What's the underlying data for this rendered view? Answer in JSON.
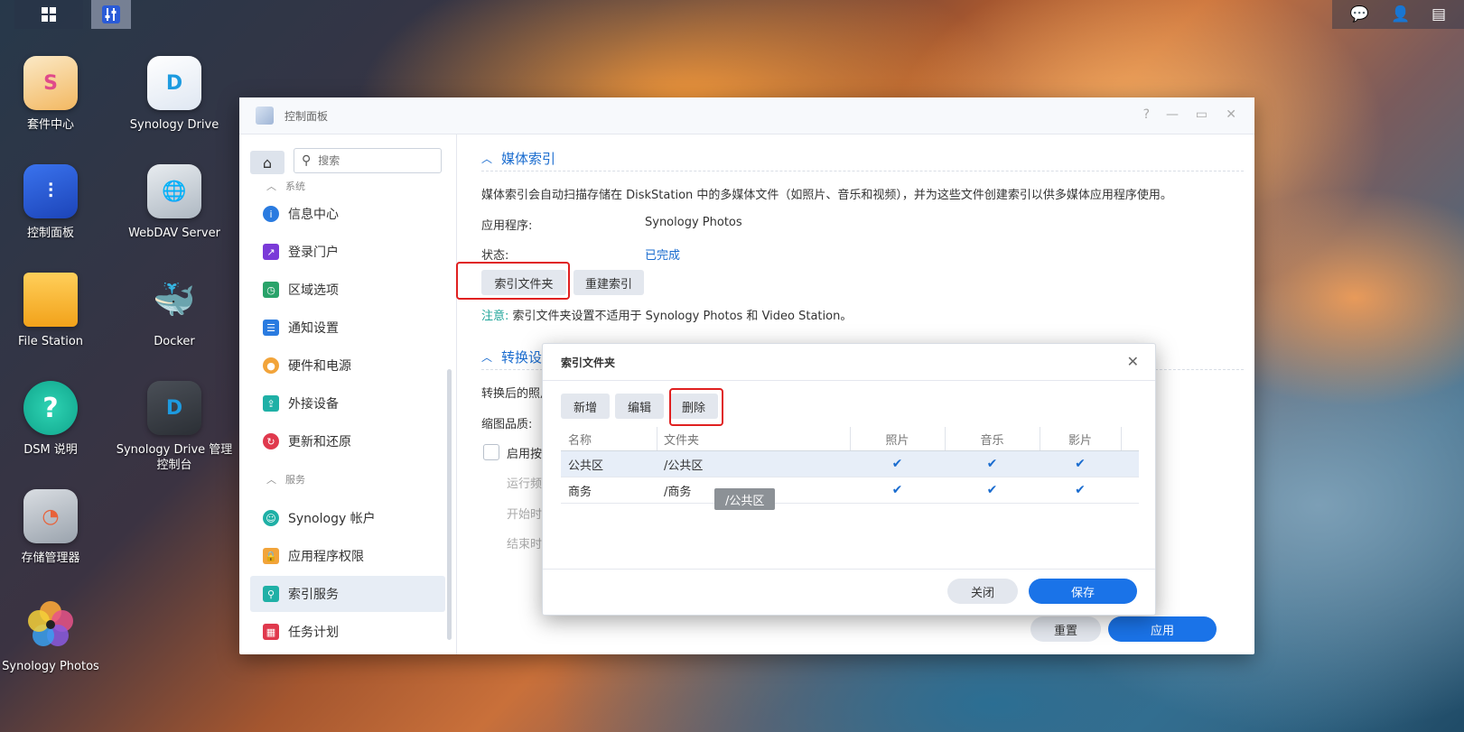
{
  "desktop": {
    "icons": [
      {
        "label": "套件中心"
      },
      {
        "label": "Synology Drive"
      },
      {
        "label": "控制面板"
      },
      {
        "label": "WebDAV Server"
      },
      {
        "label": "File Station"
      },
      {
        "label": "Docker"
      },
      {
        "label": "DSM 说明"
      },
      {
        "label": "Synology Drive 管理控制台"
      },
      {
        "label": "存储管理器"
      },
      {
        "label": "Synology Photos"
      }
    ]
  },
  "window": {
    "title": "控制面板",
    "controls": {
      "help": "?",
      "minimize": "—",
      "maximize": "▭",
      "close": "✕"
    }
  },
  "sidebar": {
    "search_placeholder": "搜索",
    "section_system": "系统",
    "section_services": "服务",
    "items": [
      {
        "label": "信息中心"
      },
      {
        "label": "登录门户"
      },
      {
        "label": "区域选项"
      },
      {
        "label": "通知设置"
      },
      {
        "label": "硬件和电源"
      },
      {
        "label": "外接设备"
      },
      {
        "label": "更新和还原"
      },
      {
        "label": "Synology 帐户"
      },
      {
        "label": "应用程序权限"
      },
      {
        "label": "索引服务"
      },
      {
        "label": "任务计划"
      }
    ],
    "active_item": "索引服务"
  },
  "main": {
    "media_index": {
      "heading": "媒体索引",
      "description": "媒体索引会自动扫描存储在 DiskStation 中的多媒体文件（如照片、音乐和视频），并为这些文件创建索引以供多媒体应用程序使用。",
      "app_label": "应用程序:",
      "app_value": "Synology Photos",
      "status_label": "状态:",
      "status_value": "已完成",
      "btn_index_folder": "索引文件夹",
      "btn_rebuild": "重建索引",
      "note_prefix": "注意:",
      "note_text": "索引文件夹设置不适用于 Synology Photos 和 Video Station。"
    },
    "conversion": {
      "heading": "转换设",
      "line1": "转换后的照片",
      "thumb_quality": "缩图品质:",
      "enable_label": "启用按",
      "run_freq": "运行频率",
      "start_time": "开始时",
      "end_time": "结束时"
    },
    "footer": {
      "reset": "重置",
      "apply": "应用"
    }
  },
  "dialog": {
    "title": "索引文件夹",
    "buttons": {
      "add": "新增",
      "edit": "编辑",
      "delete": "删除"
    },
    "columns": [
      "名称",
      "文件夹",
      "照片",
      "音乐",
      "影片"
    ],
    "rows": [
      {
        "name": "公共区",
        "folder": "/公共区",
        "photo": "✔",
        "music": "✔",
        "video": "✔"
      },
      {
        "name": "商务",
        "folder": "/商务",
        "photo": "✔",
        "music": "✔",
        "video": "✔"
      }
    ],
    "tooltip": "/公共区",
    "close_btn": "关闭",
    "save_btn": "保存"
  }
}
